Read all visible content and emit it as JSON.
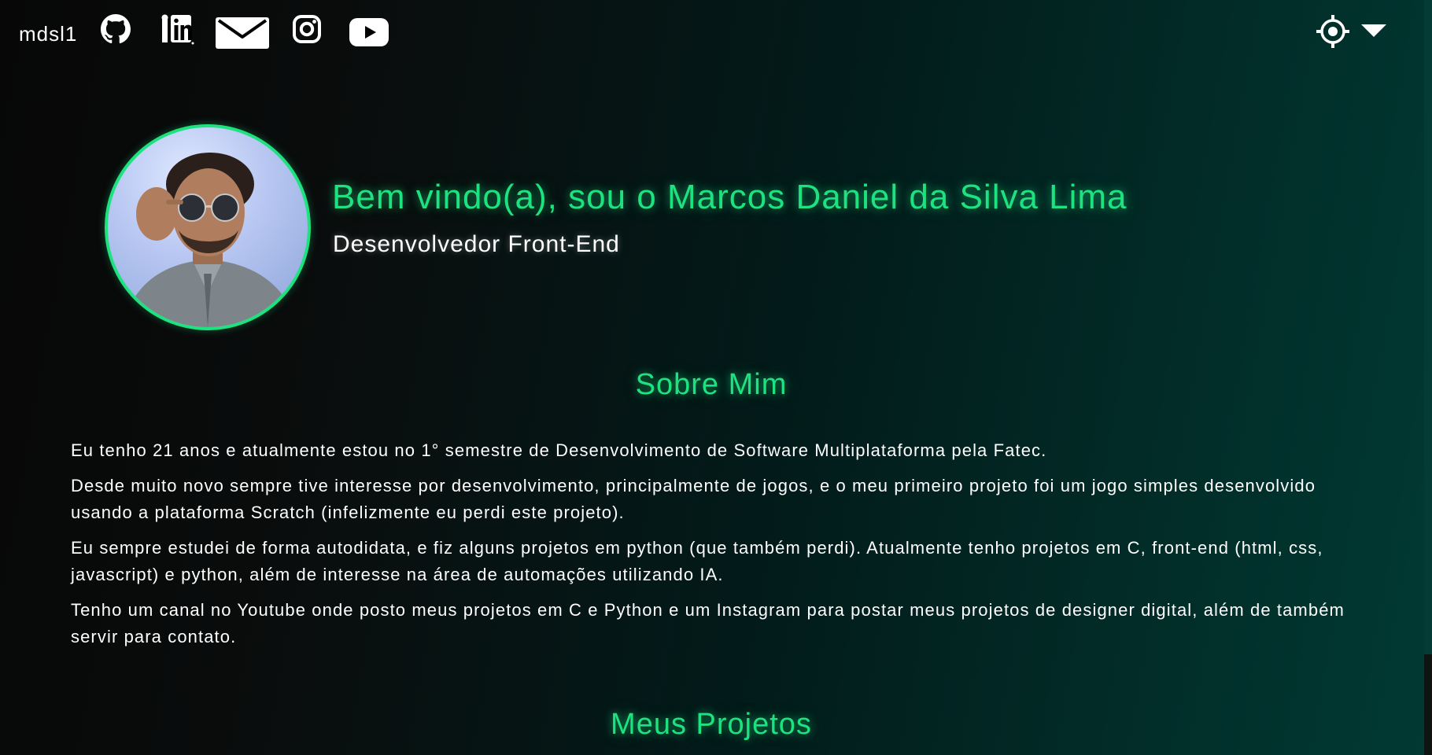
{
  "header": {
    "username": "mdsl1",
    "social_icons": [
      "github-icon",
      "linkedin-icon",
      "mail-icon",
      "instagram-icon",
      "youtube-icon"
    ],
    "theme_icon": "sun-icon",
    "dropdown_icon": "caret-down-icon"
  },
  "hero": {
    "title": "Bem vindo(a), sou o Marcos Daniel da Silva Lima",
    "subtitle": "Desenvolvedor Front-End"
  },
  "about": {
    "heading": "Sobre Mim",
    "paragraphs": [
      "Eu tenho 21 anos e atualmente estou no 1° semestre de Desenvolvimento de Software Multiplataforma pela Fatec.",
      "Desde muito novo sempre tive interesse por desenvolvimento, principalmente de jogos, e o meu primeiro projeto foi um jogo simples desenvolvido usando a plataforma Scratch (infelizmente eu perdi este projeto).",
      "Eu sempre estudei de forma autodidata, e fiz alguns projetos em python (que também perdi). Atualmente tenho projetos em C, front-end (html, css, javascript) e python, além de interesse na área de automações utilizando IA.",
      "Tenho um canal no Youtube onde posto meus projetos em C e Python e um Instagram para postar meus projetos de designer digital, além de também servir para contato."
    ]
  },
  "projects": {
    "heading": "Meus Projetos"
  },
  "colors": {
    "accent": "#1ee27f",
    "text": "#ffffff",
    "background_dark": "#070707",
    "background_teal": "#013a33"
  }
}
